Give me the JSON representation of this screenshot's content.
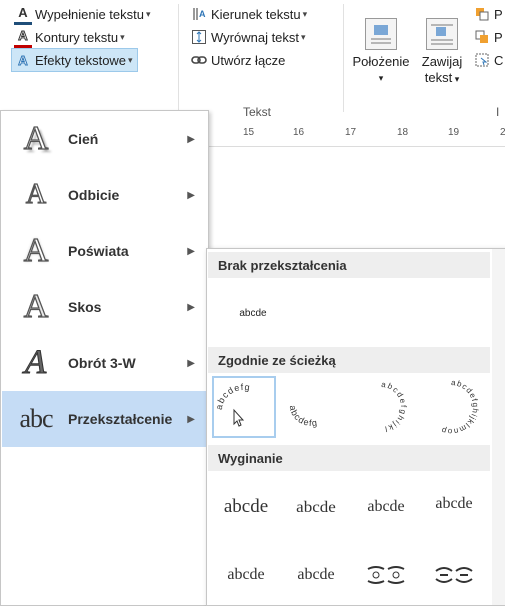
{
  "ribbon": {
    "text_fill": "Wypełnienie tekstu",
    "text_outline": "Kontury tekstu",
    "text_effects": "Efekty tekstowe",
    "text_direction": "Kierunek tekstu",
    "align_text": "Wyrównaj tekst",
    "create_link": "Utwórz łącze",
    "group_text": "Tekst",
    "position_line1": "Położenie",
    "wrap_line1": "Zawijaj",
    "wrap_line2": "tekst",
    "partial_right_1": "P",
    "partial_right_2": "P",
    "partial_right_3": "C",
    "partial_group": "I"
  },
  "ruler": [
    "15",
    "16",
    "17",
    "18",
    "19",
    "2"
  ],
  "effects_menu": {
    "items": [
      {
        "label": "Cień"
      },
      {
        "label": "Odbicie"
      },
      {
        "label": "Poświata"
      },
      {
        "label": "Skos"
      },
      {
        "label": "Obrót 3-W"
      },
      {
        "label": "Przekształcenie"
      }
    ],
    "transform_icon_text": "abc"
  },
  "gallery": {
    "no_transform_header": "Brak przekształcenia",
    "no_transform_sample": "abcde",
    "follow_path_header": "Zgodnie ze ścieżką",
    "path_samples": [
      "abcdefg",
      "abcdefg",
      "abcdefghijkl",
      "abcdefghijklmnop"
    ],
    "warp_header": "Wyginanie",
    "warp_samples": [
      "abcde",
      "abcde",
      "abcde",
      "abcde",
      "abcde",
      "abcde"
    ],
    "warp_garbled": [
      "",
      ""
    ]
  },
  "colors": {
    "highlight": "#cde6f7",
    "menu_active": "#c5dcf5",
    "fill_red": "#c00000",
    "effect_blue": "#2e75b6"
  }
}
